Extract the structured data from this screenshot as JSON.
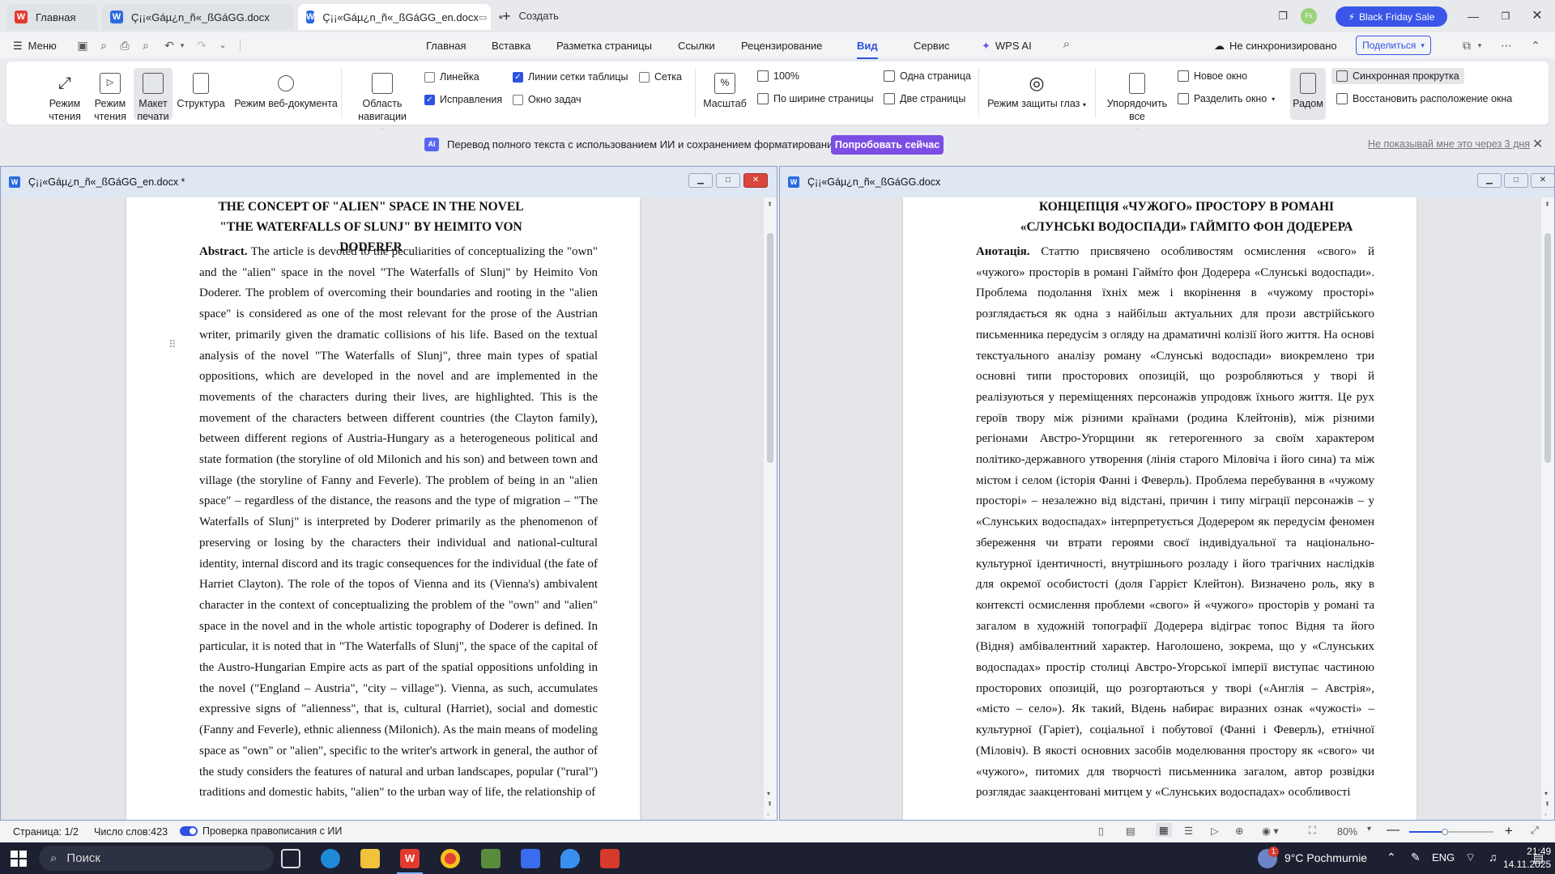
{
  "tabs": [
    {
      "label": "Главная"
    },
    {
      "label": "Ç¡¡«Gáµ¿n_ñ«_ßGáGG.docx"
    },
    {
      "label": "Ç¡¡«Gáµ¿n_ñ«_ßGáGG_en.docx"
    }
  ],
  "new_tab_label": "Создать",
  "black_friday": "Black Friday Sale",
  "menu": {
    "label": "Меню",
    "ribbon_tabs": [
      "Главная",
      "Вставка",
      "Разметка страницы",
      "Ссылки",
      "Рецензирование",
      "Вид",
      "Сервис",
      "WPS AI"
    ],
    "sync_status": "Не синхронизировано",
    "share": "Поделиться"
  },
  "ribbon": {
    "reading_mode_1": "Режим чтения",
    "reading_mode_2": "Режим чтения",
    "print_layout": "Макет печати",
    "structure": "Структура",
    "web_mode": "Режим веб-документа",
    "nav_area": "Область навигации",
    "ruler": "Линейка",
    "table_gridlines": "Линии сетки таблицы",
    "grid": "Сетка",
    "revisions": "Исправления",
    "task_pane": "Окно задач",
    "zoom": "Масштаб",
    "zoom_100": "100%",
    "page_width": "По ширине страницы",
    "one_page": "Одна страница",
    "two_pages": "Две страницы",
    "eye_mode": "Режим защиты глаз",
    "arrange_all": "Упорядочить все",
    "new_window": "Новое окно",
    "split_window": "Разделить окно",
    "side_by_side": "Радом",
    "sync_scroll": "Синхронная прокрутка",
    "restore_layout": "Восстановить расположение окна"
  },
  "notification": {
    "ai_badge": "AI",
    "message": "Перевод полного текста с использованием ИИ и сохранением форматирования.",
    "try_now": "Попробовать сейчас",
    "dont_show": "Не показывай мне это через 3 дня"
  },
  "left_doc": {
    "title": "Ç¡¡«Gáµ¿n_ñ«_ßGáGG_en.docx *",
    "heading": "THE CONCEPT OF \"ALIEN\" SPACE IN THE NOVEL \"THE WATERFALLS OF SLUNJ\" BY HEIMITO VON DODERER",
    "abstract_label": "Abstract.",
    "abstract_text": " The article is devoted to the peculiarities of conceptualizing the \"own\" and the \"alien\" space in the novel \"The Waterfalls of Slunj\" by Heimito Von Doderer. The problem of overcoming their boundaries and rooting in the \"alien space\" is considered as one of the most relevant for the prose of the Austrian writer, primarily given the dramatic collisions of his life. Based on the textual analysis of the novel \"The Waterfalls of Slunj\", three main types of spatial oppositions, which are developed in the novel and are implemented in the movements of the characters during their lives, are highlighted. This is the movement of the characters between different countries (the Clayton family), between different regions of Austria-Hungary as a heterogeneous political and state formation (the storyline of old Milonich and his son) and between town and village (the storyline of Fanny and Feverle). The problem of being in an \"alien space\" – regardless of the distance, the reasons and the type of migration – \"The Waterfalls of Slunj\" is interpreted by Doderer primarily as the phenomenon of preserving or losing by the characters their individual and national-cultural identity, internal discord and its tragic consequences for the individual (the fate of Harriet Clayton). The role of the topos of Vienna and its (Vienna's) ambivalent character in the context of conceptualizing the problem of the \"own\" and \"alien\" space in the novel and in the whole artistic topography of Doderer is defined. In particular, it is noted that in \"The Waterfalls of Slunj\", the space of the capital of the Austro-Hungarian Empire acts as part of the spatial oppositions unfolding in the novel (\"England – Austria\", \"city – village\"). Vienna, as such, accumulates expressive signs of \"alienness\", that is, cultural (Harriet), social and domestic (Fanny and Feverle), ethnic alienness (Milonich). As the main means of modeling space as \"own\" or \"alien\", specific to the writer's artwork in general, the author of the study considers the features of natural and urban landscapes, popular (\"rural\") traditions and domestic habits, \"alien\" to the urban way of life, the relationship of"
  },
  "right_doc": {
    "title": "Ç¡¡«Gáµ¿n_ñ«_ßGáGG.docx",
    "heading": "КОНЦЕПЦІЯ «ЧУЖОГО» ПРОСТОРУ В РОМАНІ «СЛУНСЬКІ ВОДОСПАДИ» ГАЙМІТО ФОН ДОДЕРЕРА",
    "abstract_label": "Анотація.",
    "abstract_text": " Статтю присвячено особливостям осмислення «свого» й «чужого» просторів в романі Гаймíто фон Додерера «Слунські водоспади». Проблема подолання їхніх меж і вкорінення в «чужому просторі» розглядається як одна з найбільш актуальних для прози австрійського письменника передусім з огляду на драматичні колізії його життя. На основі текстуального аналізу роману «Слунські водоспади» виокремлено три основні типи просторових опозицій, що розробляються у творі й реалізуються у переміщеннях персонажів упродовж їхнього життя. Це рух героїв твору між різними країнами (родина Клейтонів), між різними регіонами Австро-Угорщини як гетерогенного за своїм характером політико-державного утворення (лінія старого Міловіча і його сина) та між містом і селом (історія Фанні і Феверль). Проблема перебування в «чужому просторі» – незалежно від відстані, причин і типу міграції персонажів – у «Слунських водоспадах» інтерпретується Додерером як передусім феномен збереження чи втрати героями своєї індивідуальної та національно-культурної ідентичності, внутрішнього розладу і його трагічних наслідків для окремої особистості (доля Гаррієт Клейтон). Визначено роль, яку в контексті осмислення проблеми «свого» й «чужого» просторів у романі та загалом в художній топографії Додерера відіграє топос Відня та його (Відня) амбівалентний характер. Наголошено, зокрема, що у «Слунських водоспадах» простір столиці Австро-Угорської імперії виступає частиною просторових опозицій, що розгортаються у творі («Англія – Австрія», «місто – село»). Як такий, Відень набирає виразних ознак «чужості» – культурної (Гаріет), соціальної і побутової (Фанні і Феверль), етнічної (Міловіч). В якості основних засобів моделювання простору як «свого» чи «чужого», питомих для творчості письменника загалом, автор розвідки розглядає заакцентовані митцем у «Слунських водоспадах» особливості"
  },
  "status": {
    "page": "Страница: 1/2",
    "words": "Число слов:423",
    "spellcheck": "Проверка правописания с ИИ",
    "zoom": "80%"
  },
  "taskbar": {
    "search": "Поиск",
    "weather": "9°C  Pochmurnie",
    "lang": "ENG",
    "time": "21:49",
    "date": "14.11.2025",
    "notif_count": "1"
  }
}
